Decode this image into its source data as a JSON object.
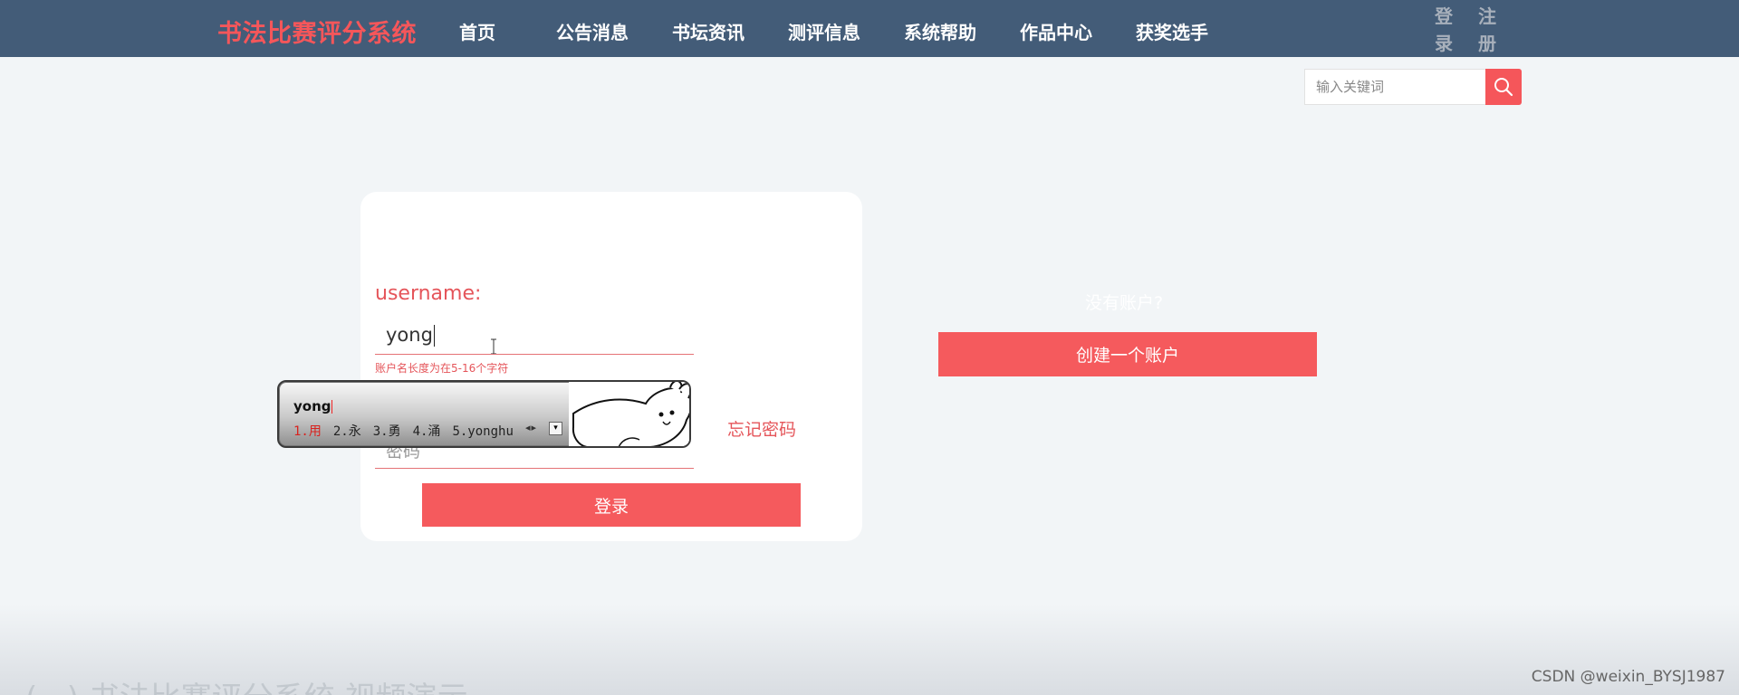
{
  "header": {
    "brand": "书法比赛评分系统",
    "nav": [
      {
        "label": "首页"
      },
      {
        "label": "公告消息"
      },
      {
        "label": "书坛资讯"
      },
      {
        "label": "测评信息"
      },
      {
        "label": "系统帮助"
      },
      {
        "label": "作品中心"
      },
      {
        "label": "获奖选手"
      }
    ],
    "login": [
      "登",
      "录"
    ],
    "register": [
      "注",
      "册"
    ]
  },
  "search": {
    "placeholder": "输入关键词",
    "icon": "search-icon"
  },
  "login_form": {
    "username_label": "username:",
    "username_value": "yong",
    "username_hint": "账户名长度为在5-16个字符",
    "password_placeholder": "密码",
    "forgot_label": "忘记密码",
    "submit_label": "登录"
  },
  "register_panel": {
    "prompt": "没有账户?",
    "create_label": "创建一个账户"
  },
  "ime": {
    "composition": "yong",
    "candidates": [
      "1.用",
      "2.永",
      "3.勇",
      "4.涌",
      "5.yonghu"
    ]
  },
  "footer": {
    "ghost_title": "(...) 书法比赛评分系统 视频演示",
    "watermark": "CSDN @weixin_BYSJ1987"
  },
  "colors": {
    "header_bg": "#435c78",
    "accent": "#f5565a",
    "page_bg": "#f2f5f7"
  }
}
